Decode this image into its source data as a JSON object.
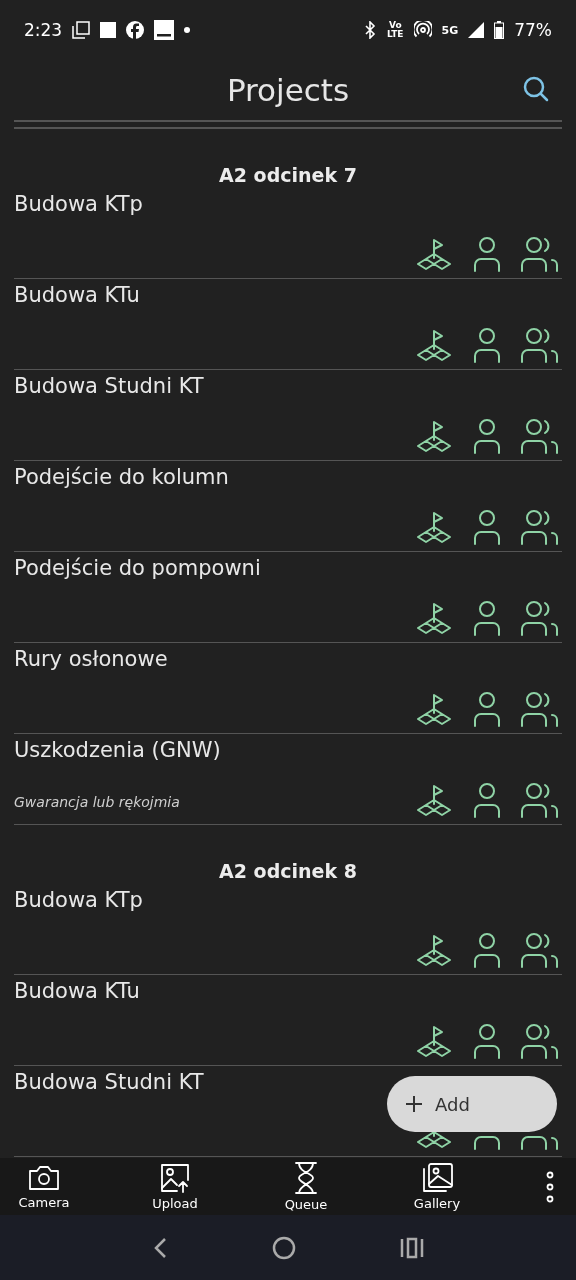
{
  "status_bar": {
    "time": "2:23",
    "volte": [
      "Vo",
      "LTE"
    ],
    "network": "5G",
    "battery": "77%"
  },
  "header": {
    "title": "Projects"
  },
  "groups": [
    {
      "title": "A2 odcinek 7",
      "projects": [
        {
          "name": "Budowa KTp"
        },
        {
          "name": "Budowa KTu"
        },
        {
          "name": "Budowa Studni KT"
        },
        {
          "name": "Podejście do kolumn"
        },
        {
          "name": "Podejście do pompowni"
        },
        {
          "name": "Rury osłonowe"
        },
        {
          "name": "Uszkodzenia (GNW)",
          "subtitle": "Gwarancja lub rękojmia"
        }
      ]
    },
    {
      "title": "A2 odcinek 8",
      "projects": [
        {
          "name": "Budowa KTp"
        },
        {
          "name": "Budowa KTu"
        },
        {
          "name": "Budowa Studni KT"
        }
      ]
    }
  ],
  "fab": {
    "label": "Add"
  },
  "bottom_bar": [
    {
      "kind": "camera",
      "label": "Camera"
    },
    {
      "kind": "upload",
      "label": "Upload"
    },
    {
      "kind": "queue",
      "label": "Queue"
    },
    {
      "kind": "gallery",
      "label": "Gallery"
    },
    {
      "kind": "more"
    }
  ]
}
